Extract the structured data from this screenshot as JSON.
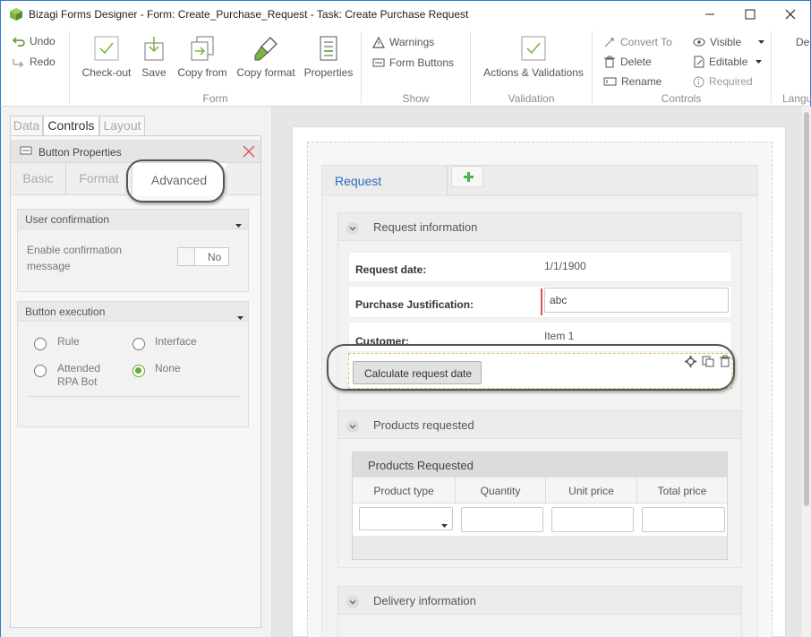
{
  "window": {
    "title": "Bizagi Forms Designer  - Form: Create_Purchase_Request - Task:  Create Purchase Request"
  },
  "ribbon": {
    "undo": "Undo",
    "redo": "Redo",
    "form_group": {
      "label": "Form",
      "buttons": [
        "Check-out",
        "Save",
        "Copy from",
        "Copy format",
        "Properties"
      ]
    },
    "show_group": {
      "label": "Show",
      "warnings": "Warnings",
      "form_buttons": "Form Buttons"
    },
    "validation_group": {
      "label": "Validation",
      "actions": "Actions & Validations"
    },
    "controls_group": {
      "label": "Controls",
      "convert_to": "Convert To",
      "delete": "Delete",
      "rename": "Rename",
      "visible": "Visible",
      "editable": "Editable",
      "required": "Required"
    },
    "truncated_right": {
      "top": "De",
      "label": "Langu"
    }
  },
  "left_panel": {
    "tabs": [
      "Data",
      "Controls",
      "Layout"
    ],
    "props_title": "Button Properties",
    "subtabs": [
      "Basic",
      "Format",
      "Advanced"
    ],
    "user_confirmation": {
      "title": "User confirmation",
      "label_line1": "Enable confirmation",
      "label_line2": "message",
      "toggle_value": "No"
    },
    "button_execution": {
      "title": "Button execution",
      "options": [
        {
          "line1": "Rule",
          "line2": "",
          "selected": false
        },
        {
          "line1": "Interface",
          "line2": "",
          "selected": false
        },
        {
          "line1": "Attended",
          "line2": "RPA Bot",
          "selected": false
        },
        {
          "line1": "None",
          "line2": "",
          "selected": true
        }
      ]
    }
  },
  "form": {
    "tab": "Request",
    "add_tab_icon": "plus-icon",
    "sections": {
      "request_info": {
        "title": "Request information",
        "request_date_label": "Request date:",
        "request_date_value": "1/1/1900",
        "justification_label": "Purchase Justification:",
        "justification_value": "abc",
        "customer_label": "Customer:",
        "customer_value": "Item 1",
        "button_label": "Calculate request date"
      },
      "products": {
        "title": "Products requested",
        "grid_title": "Products Requested",
        "columns": [
          "Product type",
          "Quantity",
          "Unit price",
          "Total price"
        ]
      },
      "delivery": {
        "title": "Delivery information"
      }
    }
  },
  "colors": {
    "accent_blue": "#2b6cc4",
    "highlight_border": "#555555",
    "radio_selected": "#6aab2e",
    "required_marker": "#d9534f",
    "close_x": "#e05050"
  }
}
